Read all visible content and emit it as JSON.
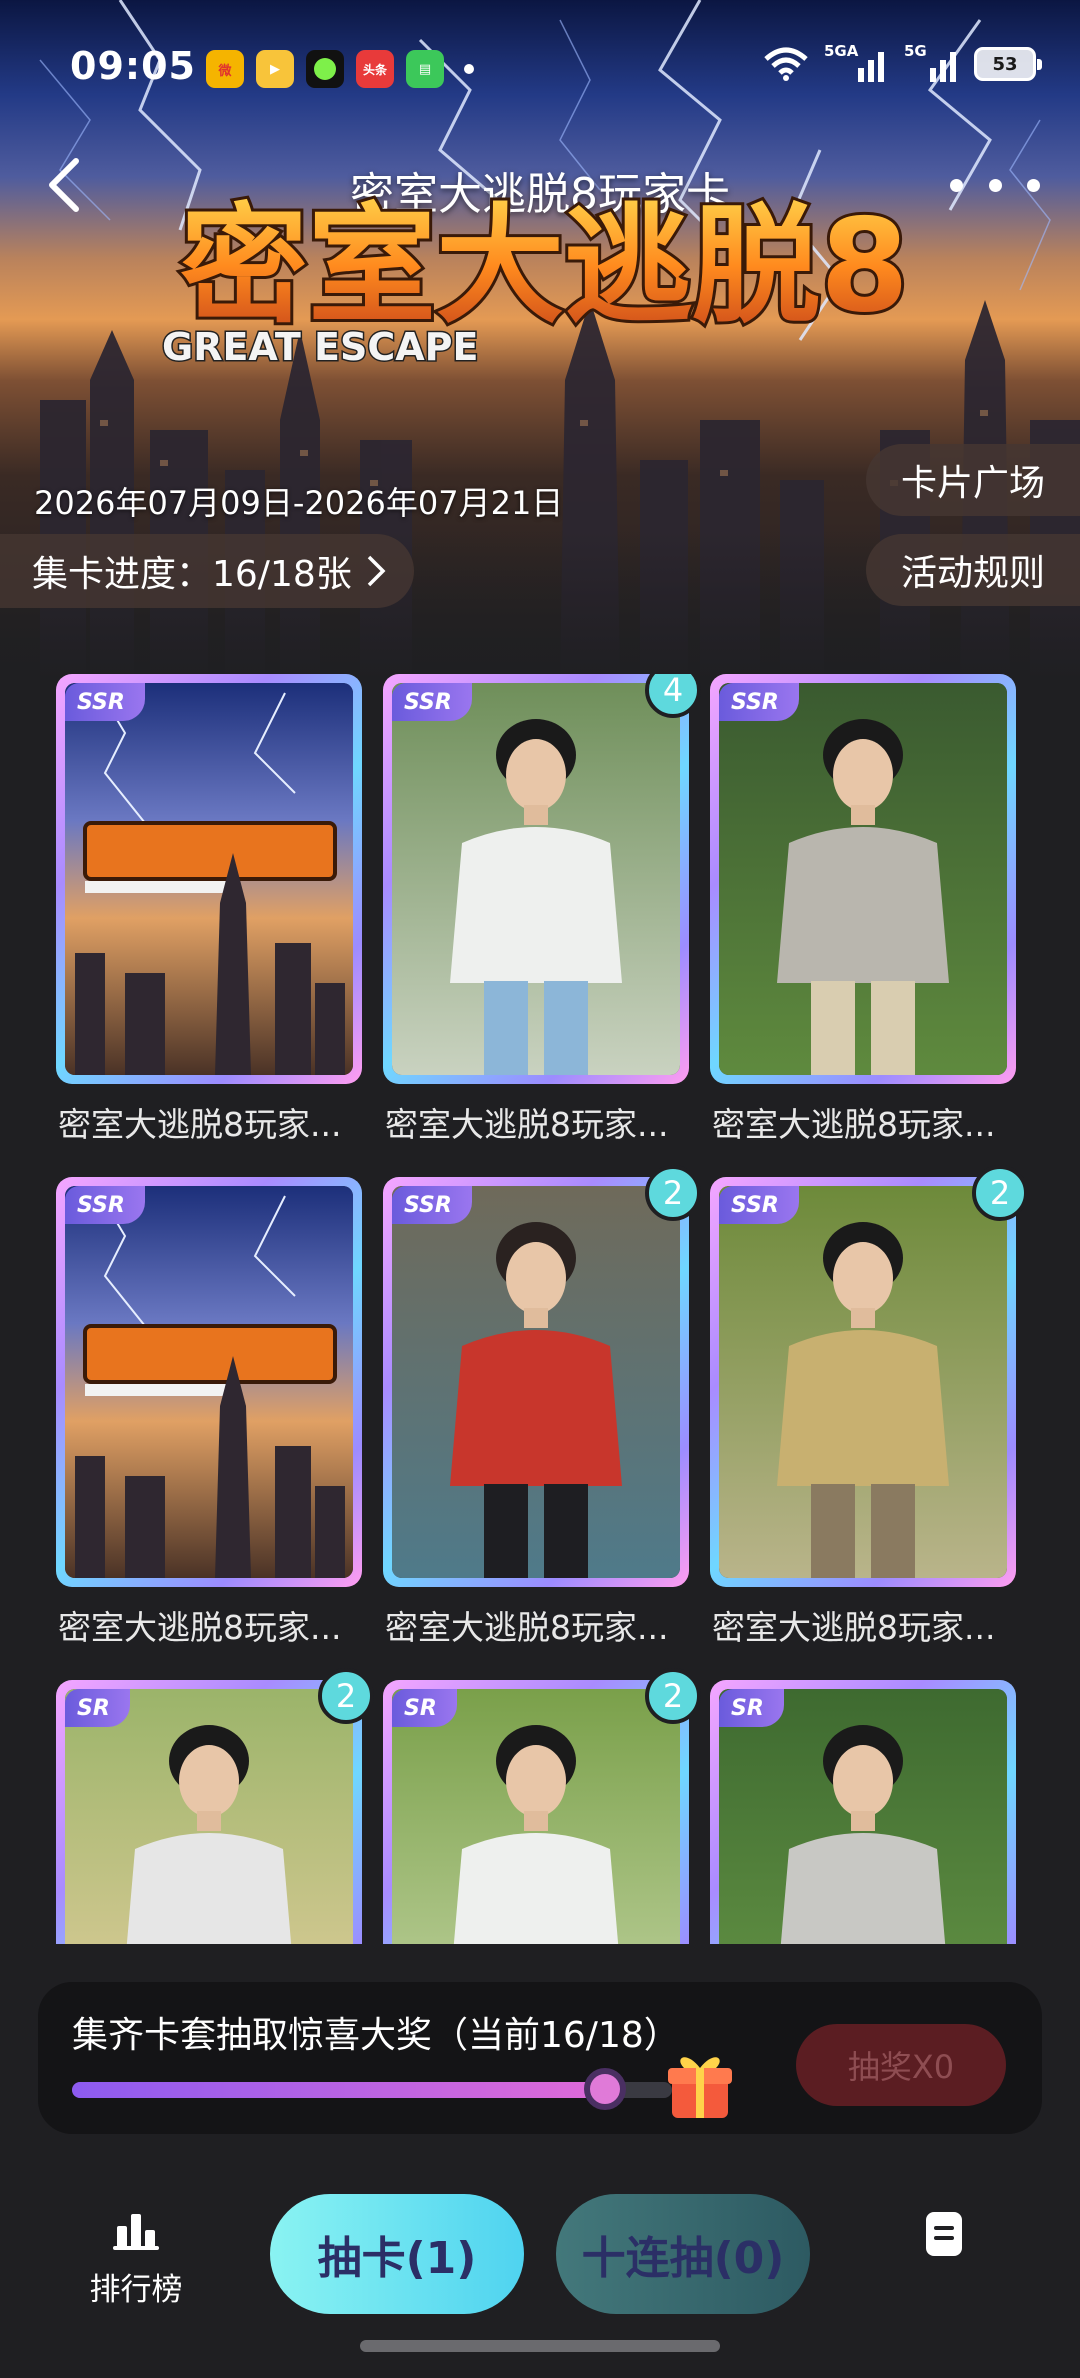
{
  "status_bar": {
    "time": "09:05",
    "apps": [
      {
        "icon": "weibo-icon",
        "color": "#f5b400"
      },
      {
        "icon": "video-app-icon",
        "color": "#f8c43a"
      },
      {
        "icon": "circle-app-icon",
        "color": "#111111"
      },
      {
        "icon": "toutiao-icon",
        "label": "头条",
        "color": "#e83a3a"
      },
      {
        "icon": "message-app-icon",
        "color": "#3cc85a"
      }
    ],
    "signal_1": "5GA",
    "signal_2": "5G",
    "battery": "53"
  },
  "nav": {
    "title": "密室大逃脱8玩家卡"
  },
  "hero": {
    "logo_text": "密室大逃脱8",
    "logo_subtitle": "GREAT ESCAPE",
    "date_range": "2026年07月09日-2026年07月21日",
    "progress_label": "集卡进度：16/18张",
    "card_plaza": "卡片广场",
    "rules": "活动规则"
  },
  "cards": [
    {
      "rarity": "SSR",
      "name": "密室大逃脱8玩家...",
      "count": "",
      "art": "poster"
    },
    {
      "rarity": "SSR",
      "name": "密室大逃脱8玩家...",
      "count": "4",
      "art": "man-white"
    },
    {
      "rarity": "SSR",
      "name": "密室大逃脱8玩家...",
      "count": "",
      "art": "man-grass"
    },
    {
      "rarity": "SSR",
      "name": "密室大逃脱8玩家...",
      "count": "",
      "art": "poster"
    },
    {
      "rarity": "SSR",
      "name": "密室大逃脱8玩家...",
      "count": "2",
      "art": "man-red"
    },
    {
      "rarity": "SSR",
      "name": "密室大逃脱8玩家...",
      "count": "2",
      "art": "man-table"
    },
    {
      "rarity": "SR",
      "name": "",
      "count": "2",
      "art": "man-sunny"
    },
    {
      "rarity": "SR",
      "name": "",
      "count": "2",
      "art": "man-garden"
    },
    {
      "rarity": "SR",
      "name": "",
      "count": "",
      "art": "man-sit"
    }
  ],
  "reward": {
    "title": "集齐卡套抽取惊喜大奖（当前16/18）",
    "progress": 0.889,
    "button": "抽奖X0"
  },
  "bottom_bar": {
    "rank_label": "排行榜",
    "draw_label": "抽卡(1)",
    "ten_draw_label": "十连抽(0)"
  }
}
